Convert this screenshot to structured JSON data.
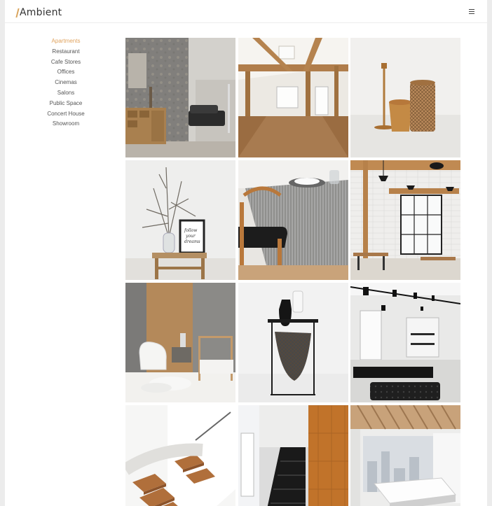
{
  "header": {
    "logo": "Ambient",
    "menu_icon": "hamburger-menu-icon"
  },
  "sidebar": {
    "active_index": 0,
    "accent_color": "#e0a35f",
    "items": [
      {
        "label": "Apartments"
      },
      {
        "label": "Restaurant"
      },
      {
        "label": "Cafe Stores"
      },
      {
        "label": "Offices"
      },
      {
        "label": "Cinemas"
      },
      {
        "label": "Salons"
      },
      {
        "label": "Public Space"
      },
      {
        "label": "Concert House"
      },
      {
        "label": "Showroom"
      }
    ]
  },
  "gallery": {
    "photos": [
      {
        "subject": "living room with stone wall, wooden cabinet and black sofa"
      },
      {
        "subject": "attic room with wooden beams and skylight"
      },
      {
        "subject": "copper candle holder, vase and lantern"
      },
      {
        "subject": "dry branches in a vase beside a framed print on a side table"
      },
      {
        "subject": "dining table with striped tablecloth and black chair"
      },
      {
        "subject": "restaurant interior with pendant lamps and large window"
      },
      {
        "subject": "bedroom with white armchair and canopy bed"
      },
      {
        "subject": "black and white vases on a magazine rack side table"
      },
      {
        "subject": "showroom with black track lights and leather bench"
      },
      {
        "subject": "wooden staircase viewed from above"
      },
      {
        "subject": "black staircase in a hall with wooden wall"
      },
      {
        "subject": "white reception desk with slatted wooden ceiling"
      }
    ]
  }
}
